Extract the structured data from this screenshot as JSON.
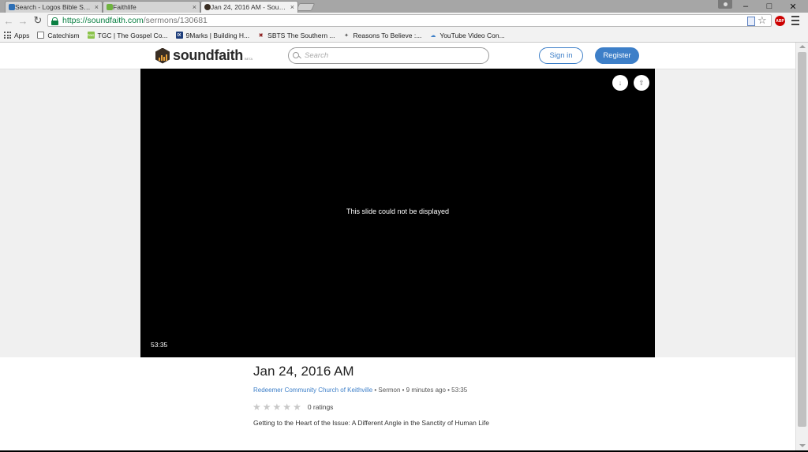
{
  "browser": {
    "tabs": [
      {
        "title": "Search - Logos Bible Softwa",
        "close": "×",
        "favicon_color": "#2e6fb5"
      },
      {
        "title": "Faithlife",
        "close": "×",
        "favicon_color": "#6fb33f"
      },
      {
        "title": "Jan 24, 2016 AM - Soundfa",
        "close": "×",
        "favicon_color": "#3a2e23"
      }
    ],
    "window_controls": {
      "minimize": "–",
      "restore": "□",
      "close": "✕"
    },
    "nav": {
      "back": "←",
      "forward": "→",
      "reload": "↻"
    },
    "url": {
      "scheme": "https://",
      "host": "soundfaith.com",
      "path": "/sermons/130681"
    },
    "extensions": {
      "abp": "ABP",
      "star": "☆"
    },
    "bookmarks": [
      {
        "label": "Apps",
        "icon": "apps-grid-icon"
      },
      {
        "label": "Catechism",
        "icon": "page-icon",
        "color": "#ffffff"
      },
      {
        "label": "TGC | The Gospel Co...",
        "icon": "tgc-icon",
        "color": "#8bc34a",
        "glyph": "TGC"
      },
      {
        "label": "9Marks | Building H...",
        "icon": "ninemarks-icon",
        "color": "#1d3d7a",
        "glyph": "IX"
      },
      {
        "label": "SBTS The Southern ...",
        "icon": "sbts-icon",
        "color": "#8b1a1a",
        "glyph": "✖"
      },
      {
        "label": "Reasons To Believe :...",
        "icon": "rtb-icon",
        "color": "#555555",
        "glyph": "✦"
      },
      {
        "label": "YouTube Video Con...",
        "icon": "youtube-converter-icon",
        "color": "#3d7fc8",
        "glyph": "☁"
      }
    ]
  },
  "site": {
    "logo_text": "soundfaith",
    "logo_beta": "BETA",
    "search_placeholder": "Search",
    "signin_label": "Sign in",
    "register_label": "Register",
    "brand_color": "#3d7fc8"
  },
  "player": {
    "message": "This slide could not be displayed",
    "duration": "53:35",
    "download_glyph": "↓",
    "share_glyph": "⇧"
  },
  "sermon": {
    "title": "Jan 24, 2016 AM",
    "church": "Redeemer Community Church of Keithville",
    "meta_rest": " • Sermon • 9 minutes ago • 53:35",
    "ratings_stars": 0,
    "ratings_label": "0 ratings",
    "description": "Getting to the Heart of the Issue: A Different Angle in the Sanctity of Human Life"
  }
}
